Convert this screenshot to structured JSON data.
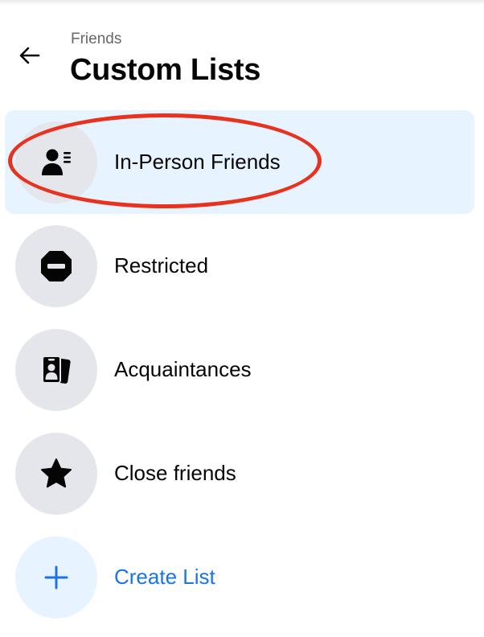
{
  "header": {
    "breadcrumb": "Friends",
    "title": "Custom Lists"
  },
  "lists": [
    {
      "label": "In-Person Friends",
      "icon": "contact-card-icon",
      "selected": true
    },
    {
      "label": "Restricted",
      "icon": "restricted-icon",
      "selected": false
    },
    {
      "label": "Acquaintances",
      "icon": "id-badges-icon",
      "selected": false
    },
    {
      "label": "Close friends",
      "icon": "star-icon",
      "selected": false
    }
  ],
  "create": {
    "label": "Create List",
    "icon": "plus-icon"
  },
  "colors": {
    "selected_background": "#e7f3ff",
    "icon_circle": "#e4e6eb",
    "link": "#1b74e4",
    "annotation_ring": "#e8321e"
  }
}
